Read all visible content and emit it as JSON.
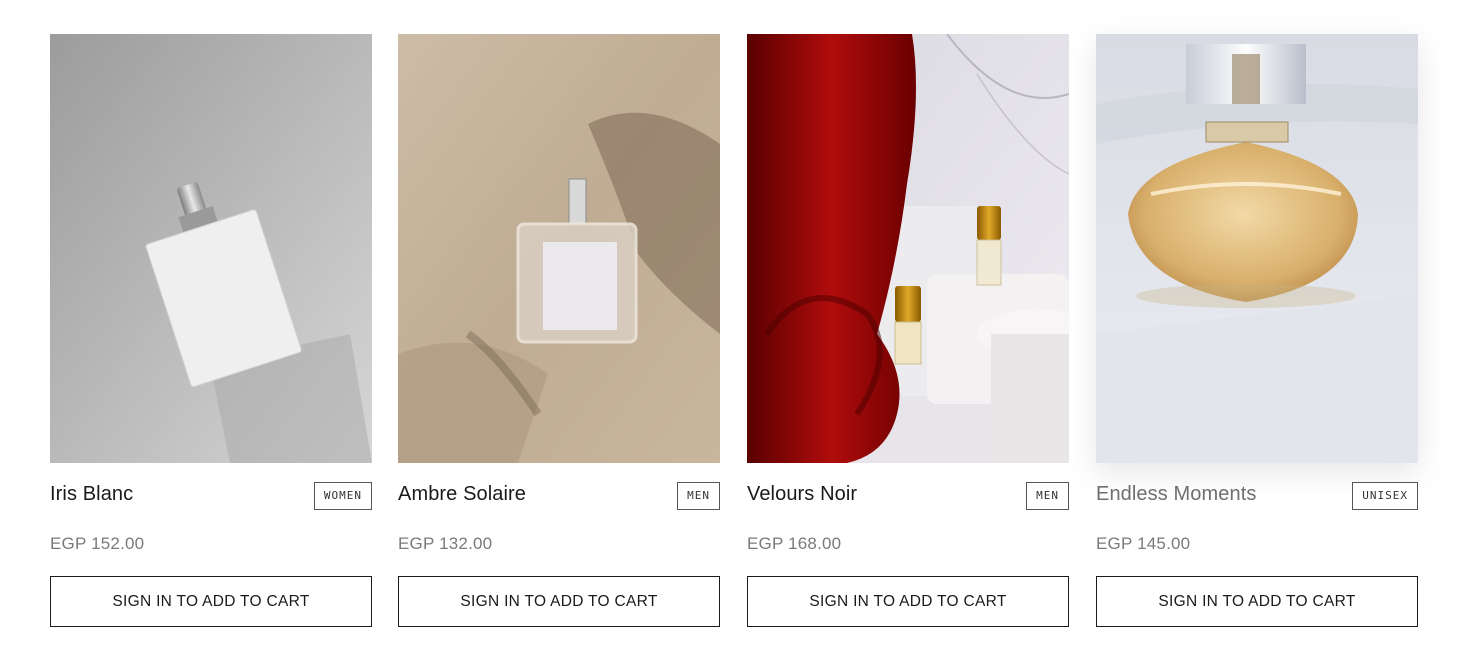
{
  "products": [
    {
      "name": "Iris Blanc",
      "tag": "WOMEN",
      "price": "EGP 152.00",
      "cta": "SIGN IN TO ADD TO CART"
    },
    {
      "name": "Ambre Solaire",
      "tag": "MEN",
      "price": "EGP 132.00",
      "cta": "SIGN IN TO ADD TO CART"
    },
    {
      "name": "Velours Noir",
      "tag": "MEN",
      "price": "EGP 168.00",
      "cta": "SIGN IN TO ADD TO CART"
    },
    {
      "name": "Endless Moments",
      "tag": "UNISEX",
      "price": "EGP 145.00",
      "cta": "SIGN IN TO ADD TO CART"
    }
  ],
  "colors": {
    "text": "#1a1a1a",
    "price": "#7a7a7a",
    "border": "#1a1a1a",
    "background": "#ffffff"
  }
}
